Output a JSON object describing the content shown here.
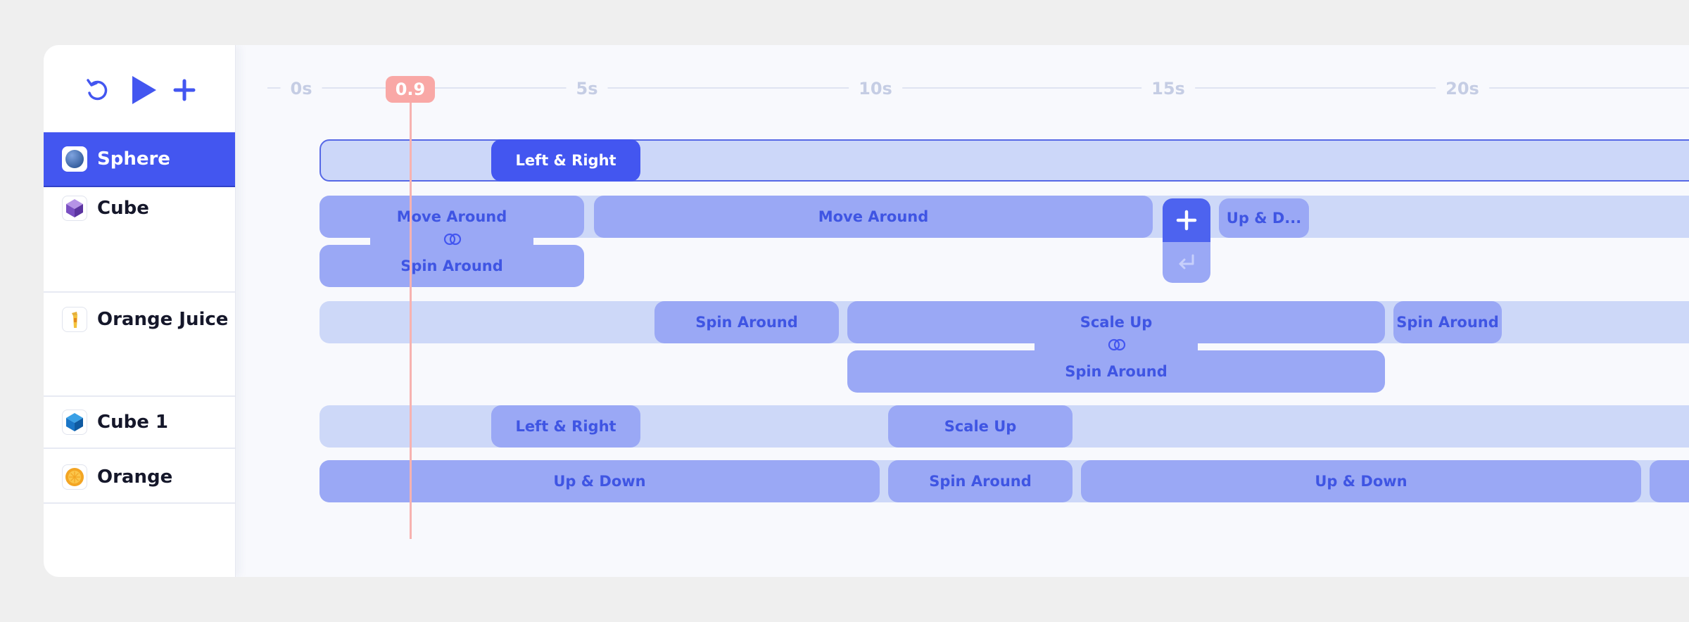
{
  "toolbar": {
    "reset_icon": "rotate-ccw-icon",
    "play_icon": "play-icon",
    "add_icon": "plus-icon"
  },
  "objects": [
    {
      "label": "Sphere",
      "icon": "sphere-icon",
      "selected": true
    },
    {
      "label": "Cube",
      "icon": "cube-icon",
      "selected": false
    },
    {
      "label": "Orange Juice",
      "icon": "orange-juice-icon",
      "selected": false
    },
    {
      "label": "Cube 1",
      "icon": "cube-1-icon",
      "selected": false
    },
    {
      "label": "Orange",
      "icon": "orange-icon",
      "selected": false
    }
  ],
  "ruler": {
    "ticks": [
      "0s",
      "5s",
      "10s",
      "15s",
      "20s"
    ],
    "playhead": "0.9"
  },
  "clips": {
    "sphere": [
      "Left & Right"
    ],
    "cube": [
      "Move Around",
      "Spin Around",
      "Move Around",
      "Up & D..."
    ],
    "orange_juice": [
      "Spin Around",
      "Scale Up",
      "Spin Around",
      "Spin Around"
    ],
    "cube_1": [
      "Left & Right",
      "Scale Up"
    ],
    "orange": [
      "Up & Down",
      "Spin Around",
      "Up & Down"
    ]
  },
  "colors": {
    "accent": "#4356f0",
    "clip": "#9aa8f5",
    "track": "#cdd8f8",
    "playhead": "#f9a8a6"
  }
}
